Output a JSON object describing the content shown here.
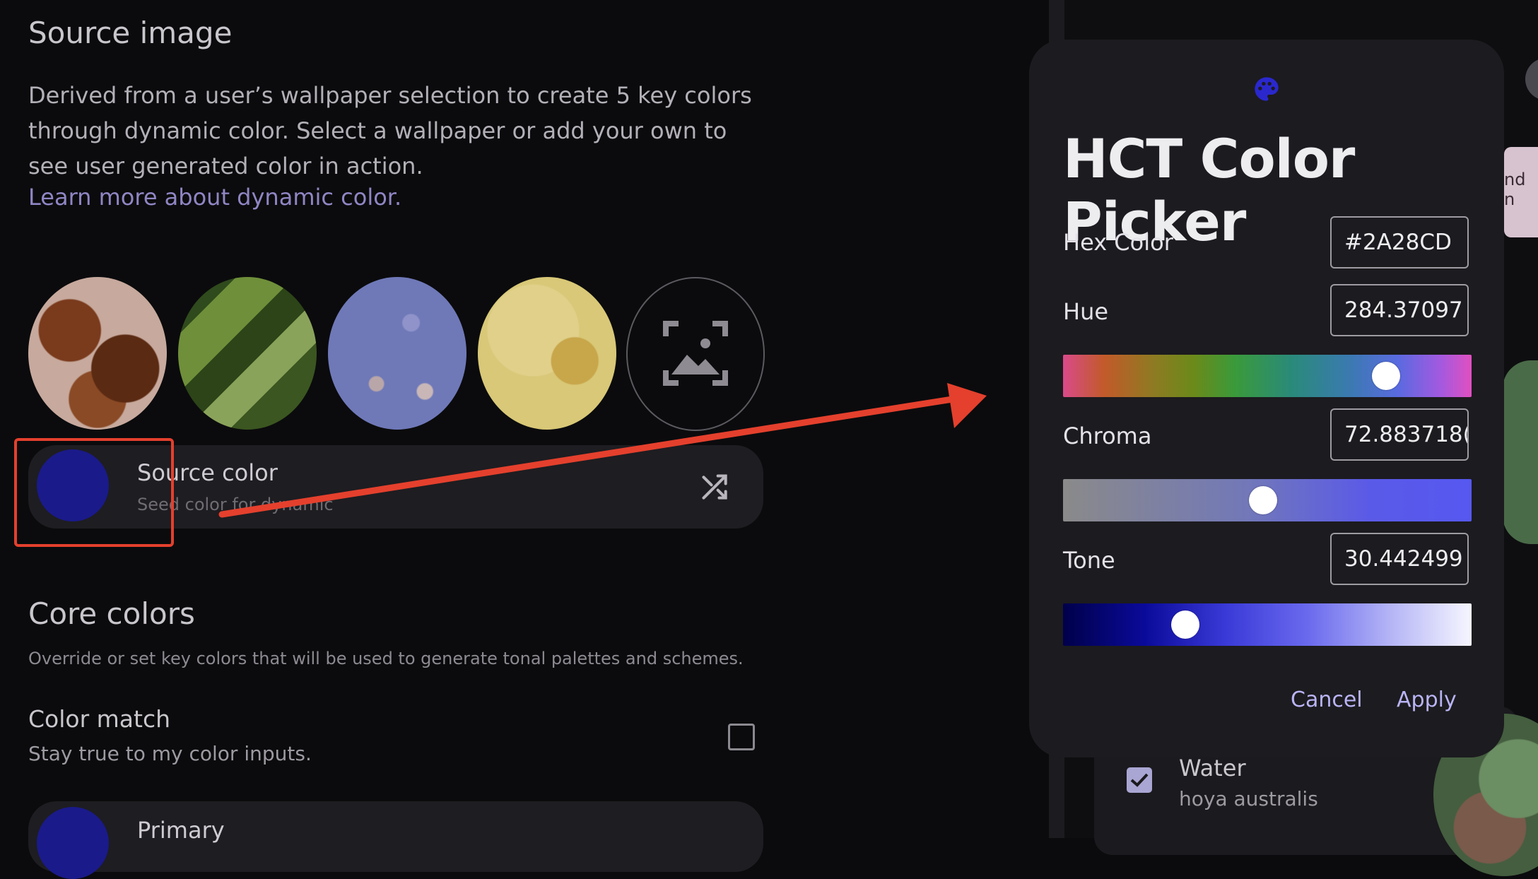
{
  "left": {
    "source_title": "Source image",
    "source_desc": "Derived from a user’s wallpaper selection to create 5 key colors through dynamic color. Select a wallpaper or add your own to see user generated color in action.",
    "learn_more": "Learn more about dynamic color.",
    "source_color_label": "Source color",
    "source_color_sub": "Seed color for dynamic",
    "core_title": "Core colors",
    "core_desc": "Override or set key colors that will be used to generate tonal palettes and schemes.",
    "color_match_title": "Color match",
    "color_match_sub": "Stay true to my color inputs.",
    "primary_label": "Primary"
  },
  "right": {
    "card_text": "nd n",
    "item_title": "Water",
    "item_sub": "hoya australis"
  },
  "dialog": {
    "title": "HCT Color Picker",
    "hex_label": "Hex Color",
    "hex_value": "#2A28CD",
    "hue_label": "Hue",
    "hue_value": "284.37097",
    "chroma_label": "Chroma",
    "chroma_value": "72.883718(",
    "tone_label": "Tone",
    "tone_value": "30.442499",
    "cancel": "Cancel",
    "apply": "Apply",
    "hue_position": 0.79,
    "chroma_position": 0.49,
    "tone_position": 0.3
  },
  "colors": {
    "source_swatch": "#1a1a8a",
    "highlight": "#e4402d",
    "arrow": "#e4402d",
    "palette_icon": "#2a28cd"
  }
}
